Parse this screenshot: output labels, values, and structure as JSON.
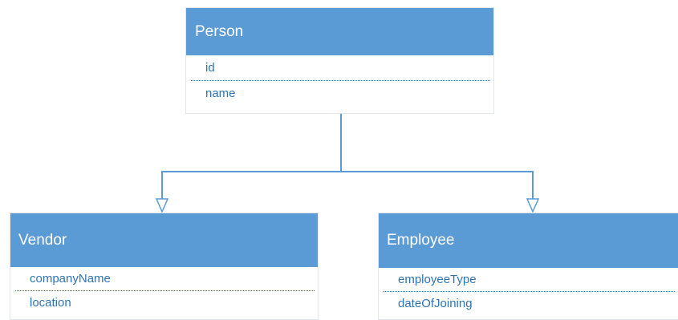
{
  "diagram": {
    "entities": {
      "person": {
        "title": "Person",
        "fields": [
          "id",
          "name"
        ]
      },
      "vendor": {
        "title": "Vendor",
        "fields": [
          "companyName",
          "location"
        ]
      },
      "employee": {
        "title": "Employee",
        "fields": [
          "employeeType",
          "dateOfJoining"
        ]
      }
    },
    "relations": [
      {
        "from": "vendor",
        "to": "person",
        "type": "inheritance"
      },
      {
        "from": "employee",
        "to": "person",
        "type": "inheritance"
      }
    ]
  },
  "colors": {
    "header": "#5b9bd5",
    "field_text": "#2e74b5",
    "connector": "#5b9bd5",
    "border": "#e3e6ea"
  }
}
